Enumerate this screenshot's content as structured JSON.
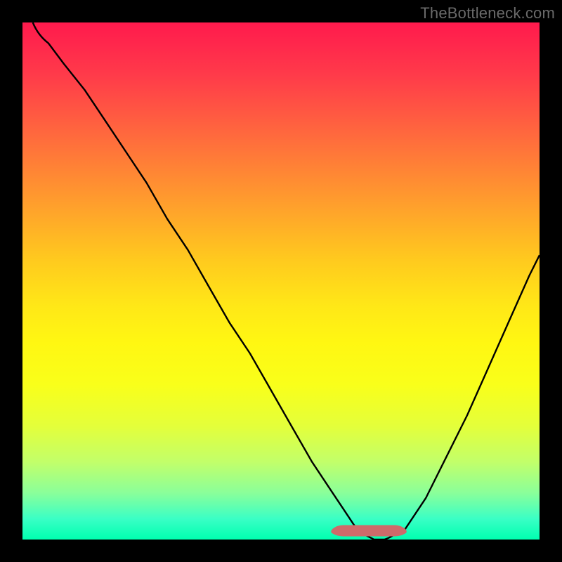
{
  "watermark": "TheBottleneck.com",
  "chart_data": {
    "type": "line",
    "title": "",
    "xlabel": "",
    "ylabel": "",
    "xlim": [
      0,
      100
    ],
    "ylim": [
      0,
      100
    ],
    "grid": false,
    "legend": null,
    "series": [
      {
        "name": "bottleneck-curve",
        "x": [
          2,
          5,
          8,
          12,
          16,
          20,
          24,
          28,
          32,
          36,
          40,
          44,
          48,
          52,
          56,
          58,
          60,
          62,
          64,
          66,
          68,
          70,
          72,
          74,
          78,
          82,
          86,
          90,
          94,
          98,
          100
        ],
        "values": [
          100,
          96,
          92,
          87,
          81,
          75,
          69,
          62,
          56,
          49,
          42,
          36,
          29,
          22,
          15,
          12,
          9,
          6,
          3,
          1,
          0,
          0,
          0,
          2,
          8,
          16,
          24,
          33,
          42,
          51,
          55
        ]
      }
    ],
    "marker": {
      "name": "sweet-spot-band",
      "x_start": 60,
      "x_end": 72,
      "y": 2,
      "color": "#cf6a6a"
    },
    "colors": {
      "curve": "#000000",
      "marker": "#cf6a6a",
      "gradient_top": "#ff1a4d",
      "gradient_bottom": "#00ffb0",
      "frame": "#000000"
    }
  }
}
